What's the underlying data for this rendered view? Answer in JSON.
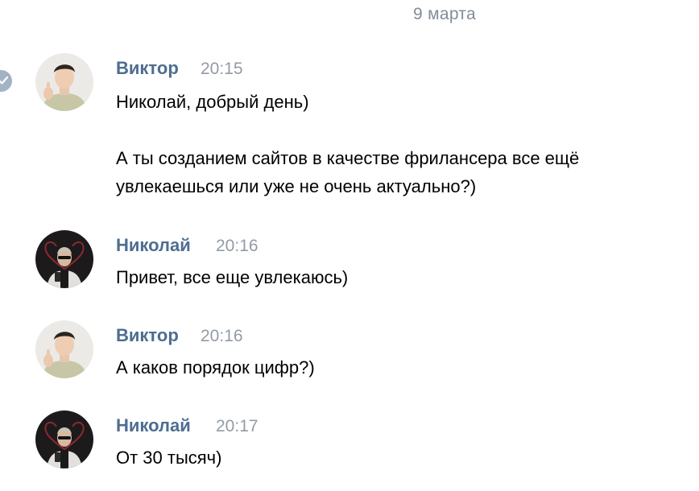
{
  "date_divider": "9 марта",
  "messages": [
    {
      "author": "Виктор",
      "time": "20:15",
      "lines": [
        "Николай, добрый день)",
        "",
        "А ты созданием сайтов в качестве фрилансера все ещё",
        "увлекаешься или уже не очень актуально?)"
      ]
    },
    {
      "author": "Николай",
      "time": "20:16",
      "lines": [
        "Привет, все еще увлекаюсь)"
      ]
    },
    {
      "author": "Виктор",
      "time": "20:16",
      "lines": [
        "А каков порядок цифр?)"
      ]
    },
    {
      "author": "Николай",
      "time": "20:17",
      "lines": [
        "От 30 тысяч)"
      ]
    }
  ],
  "colors": {
    "author_name": "#4e6d91",
    "timestamp": "#939ba6",
    "date_divider": "#818c99",
    "read_check": "#a3b3c6"
  }
}
